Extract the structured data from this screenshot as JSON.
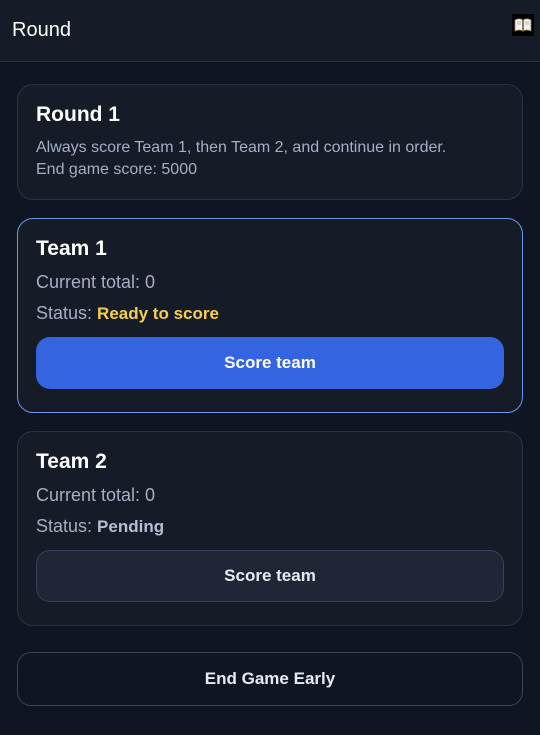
{
  "header": {
    "title": "Round",
    "icon": "book-icon"
  },
  "round": {
    "title": "Round 1",
    "description": "Always score Team 1, then Team 2, and continue in order.",
    "end_score": "End game score: 5000"
  },
  "teams": [
    {
      "name": "Team 1",
      "total": "Current total: 0",
      "status_label": "Status:",
      "status_value": "Ready to score",
      "button_label": "Score team"
    },
    {
      "name": "Team 2",
      "total": "Current total: 0",
      "status_label": "Status:",
      "status_value": "Pending",
      "button_label": "Score team"
    }
  ],
  "end_button": "End Game Early",
  "colors": {
    "background": "#0f1522",
    "card": "#151c28",
    "accent": "#3564e1",
    "ready": "#f7cf4a"
  }
}
